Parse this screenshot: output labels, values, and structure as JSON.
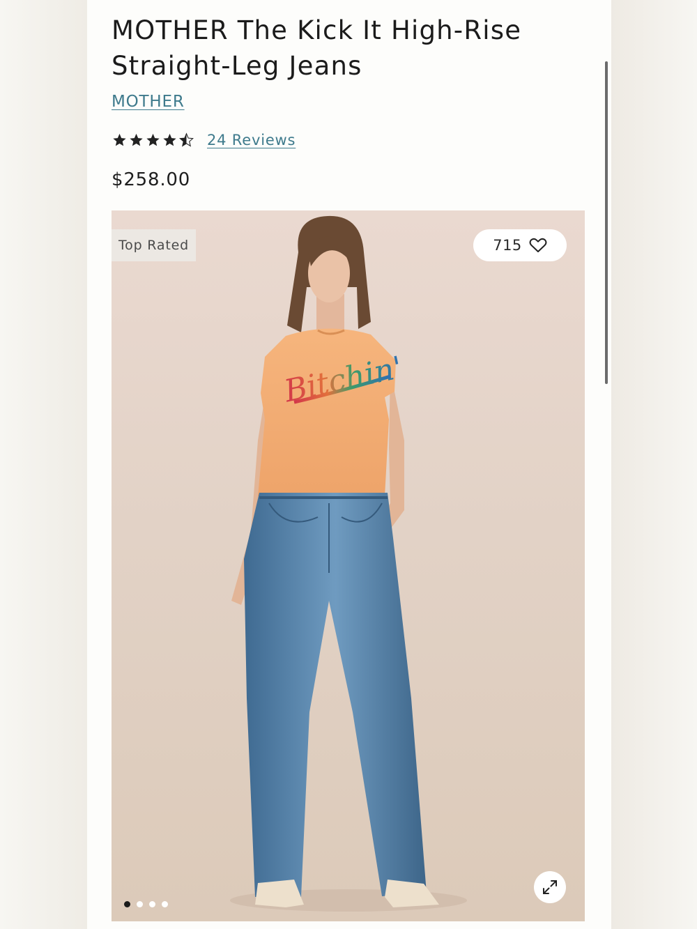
{
  "product": {
    "title": "MOTHER The Kick It High-Rise Straight-Leg Jeans",
    "brand": "MOTHER",
    "rating": 4.5,
    "reviews_label": "24 Reviews",
    "price": "$258.00"
  },
  "gallery": {
    "badge": "Top Rated",
    "likes": "715",
    "dot_count": 4,
    "active_dot": 1,
    "tee_text": "Bitchin'"
  },
  "colors": {
    "link": "#3e7a8c",
    "star": "#222222",
    "tee": "#f3ae74",
    "denim": "#4f7ba1"
  }
}
